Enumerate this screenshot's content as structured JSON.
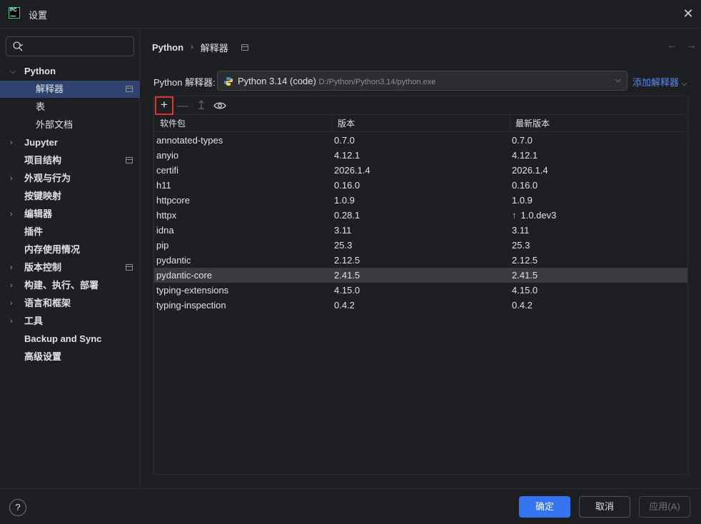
{
  "window": {
    "title": "设置",
    "app_icon_text": "PC",
    "close_glyph": "✕"
  },
  "search": {
    "placeholder": "",
    "value": ""
  },
  "sidebar": {
    "items": [
      {
        "label": "Python",
        "expanded": true,
        "chevron": "⌵"
      },
      {
        "label": "解释器",
        "selected": true
      },
      {
        "label": "表"
      },
      {
        "label": "外部文档"
      },
      {
        "label": "Jupyter",
        "chevron": "›"
      },
      {
        "label": "项目结构"
      },
      {
        "label": "外观与行为",
        "chevron": "›"
      },
      {
        "label": "按键映射"
      },
      {
        "label": "编辑器",
        "chevron": "›"
      },
      {
        "label": "插件"
      },
      {
        "label": "内存使用情况"
      },
      {
        "label": "版本控制",
        "chevron": "›"
      },
      {
        "label": "构建、执行、部署",
        "chevron": "›"
      },
      {
        "label": "语言和框架",
        "chevron": "›"
      },
      {
        "label": "工具",
        "chevron": "›"
      },
      {
        "label": "Backup and Sync"
      },
      {
        "label": "高级设置"
      }
    ]
  },
  "breadcrumb": {
    "first": "Python",
    "sep": "›",
    "second": "解释器"
  },
  "nav": {
    "back": "←",
    "forward": "→"
  },
  "interpreter": {
    "label": "Python 解释器:",
    "name": "Python 3.14 (code)",
    "path": "D:/Python/Python3.14/python.exe",
    "dropdown_glyph": "⌵",
    "add_label": "添加解释器",
    "add_chevron": "⌵"
  },
  "toolbar": {
    "add": "+",
    "remove": "—",
    "upgrade": "↥",
    "eye": "👁"
  },
  "table": {
    "headers": [
      "软件包",
      "版本",
      "最新版本"
    ],
    "rows": [
      {
        "pkg": "annotated-types",
        "ver": "0.7.0",
        "latest": "0.7.0"
      },
      {
        "pkg": "anyio",
        "ver": "4.12.1",
        "latest": "4.12.1"
      },
      {
        "pkg": "certifi",
        "ver": "2026.1.4",
        "latest": "2026.1.4"
      },
      {
        "pkg": "h11",
        "ver": "0.16.0",
        "latest": "0.16.0"
      },
      {
        "pkg": "httpcore",
        "ver": "1.0.9",
        "latest": "1.0.9"
      },
      {
        "pkg": "httpx",
        "ver": "0.28.1",
        "latest": "1.0.dev3",
        "upgrade_glyph": "↑"
      },
      {
        "pkg": "idna",
        "ver": "3.11",
        "latest": "3.11"
      },
      {
        "pkg": "pip",
        "ver": "25.3",
        "latest": "25.3"
      },
      {
        "pkg": "pydantic",
        "ver": "2.12.5",
        "latest": "2.12.5"
      },
      {
        "pkg": "pydantic-core",
        "ver": "2.41.5",
        "latest": "2.41.5",
        "selected": true
      },
      {
        "pkg": "typing-extensions",
        "ver": "4.15.0",
        "latest": "4.15.0"
      },
      {
        "pkg": "typing-inspection",
        "ver": "0.4.2",
        "latest": "0.4.2"
      }
    ]
  },
  "footer": {
    "help": "?",
    "ok": "确定",
    "cancel": "取消",
    "apply": "应用(A)"
  },
  "colors": {
    "accent": "#3574f0",
    "link": "#548af7",
    "selection": "#2e436e",
    "highlight_border": "#e0322f"
  }
}
